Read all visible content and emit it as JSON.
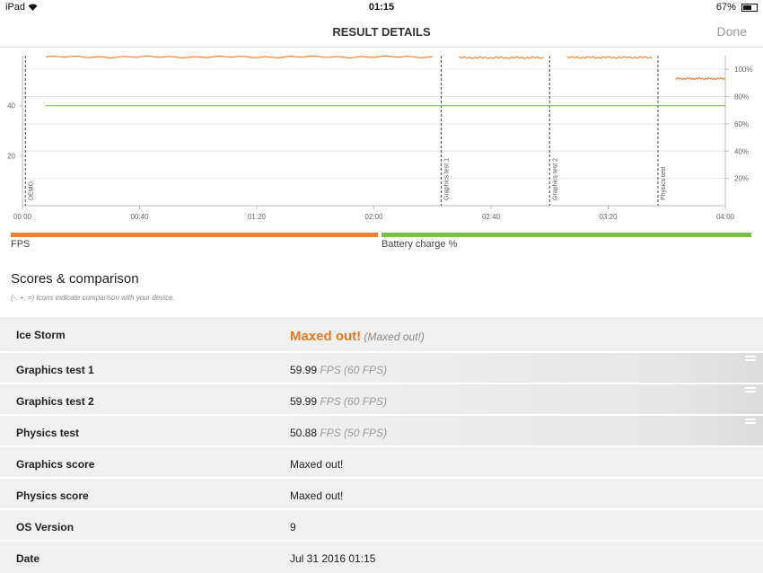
{
  "status": {
    "carrier": "iPad",
    "time": "01:15",
    "battery": "67%",
    "battery_level": 0.67
  },
  "nav": {
    "title": "RESULT DETAILS",
    "done": "Done"
  },
  "chart_data": {
    "type": "line",
    "x_ticks": [
      "00:00",
      "00:40",
      "01:20",
      "02:00",
      "02:40",
      "03:20",
      "04:00"
    ],
    "x_range_seconds": [
      0,
      240
    ],
    "y_left_ticks": [
      "20",
      "40"
    ],
    "y_left_range": [
      0,
      60
    ],
    "y_right_ticks": [
      "20%",
      "40%",
      "60%",
      "80%",
      "100%"
    ],
    "y_right_range": [
      0,
      110
    ],
    "markers": [
      {
        "label": "DEMO",
        "t": 1
      },
      {
        "label": "Graphics test 1",
        "t": 143
      },
      {
        "label": "Graphics test 2",
        "t": 180
      },
      {
        "label": "Physics test",
        "t": 217
      }
    ],
    "series": [
      {
        "name": "FPS",
        "color": "#e8833a",
        "axis": "left",
        "segments": [
          {
            "t_start": 8,
            "t_end": 140,
            "value": 59.5
          },
          {
            "t_start": 149,
            "t_end": 178,
            "value": 59.2
          },
          {
            "t_start": 186,
            "t_end": 215,
            "value": 59.3
          },
          {
            "t_start": 223,
            "t_end": 240,
            "value": 50.8
          }
        ]
      },
      {
        "name": "Battery charge %",
        "color": "#7cc04b",
        "axis": "left",
        "segments": [
          {
            "t_start": 8,
            "t_end": 240,
            "value": 40
          }
        ]
      }
    ]
  },
  "legend": {
    "fps": "FPS",
    "battery": "Battery charge %",
    "fps_color": "#e8833a",
    "battery_color": "#7cc04b"
  },
  "scores": {
    "title": "Scores & comparison",
    "subtitle": "(-, +, =) Icons indicate comparison with your device.",
    "rows": [
      {
        "label": "Ice Storm",
        "value": "Maxed out!",
        "sub": "(Maxed out!)"
      },
      {
        "label": "Graphics test 1",
        "value": "59.99",
        "sub": "FPS (60 FPS)",
        "icon": "equal-icon"
      },
      {
        "label": "Graphics test 2",
        "value": "59.99",
        "sub": "FPS (60 FPS)",
        "icon": "equal-icon"
      },
      {
        "label": "Physics test",
        "value": "50.88",
        "sub": "FPS (50 FPS)",
        "icon": "equal-icon"
      },
      {
        "label": "Graphics score",
        "value": "Maxed out!"
      },
      {
        "label": "Physics score",
        "value": "Maxed out!"
      },
      {
        "label": "OS Version",
        "value": "9"
      },
      {
        "label": "Date",
        "value": "Jul 31 2016 01:15"
      }
    ]
  }
}
